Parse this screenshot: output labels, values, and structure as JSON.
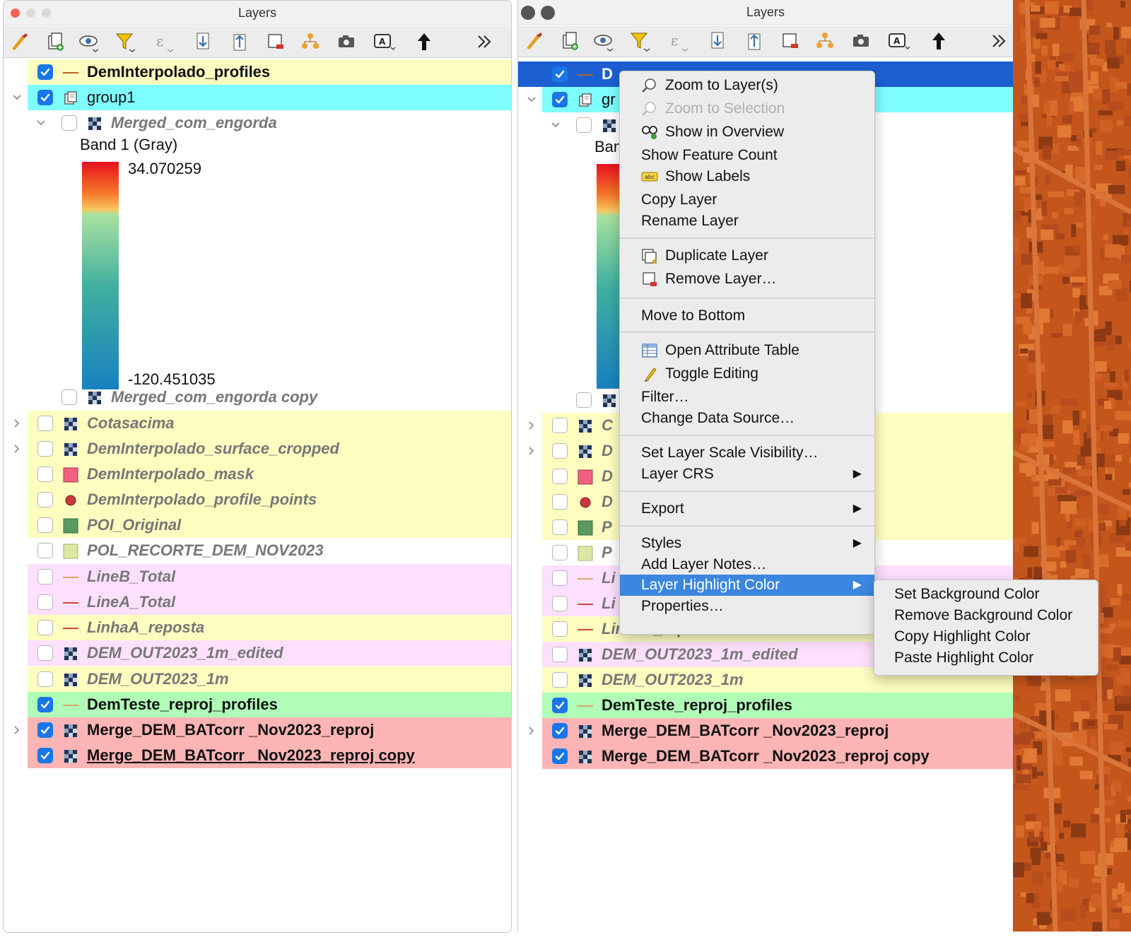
{
  "left_panel": {
    "title": "Layers",
    "layers": [
      {
        "label": "DemInterpolado_profiles",
        "checked": true,
        "style": "bold",
        "bg": "#fdfdc0",
        "symbol": "line-brown",
        "expander": ""
      },
      {
        "label": "group1",
        "checked": true,
        "style": "normal",
        "bg": "#7ffeff",
        "symbol": "group",
        "expander": "down"
      },
      {
        "label": "Merged_com_engorda",
        "checked": false,
        "style": "italic",
        "bg": "",
        "symbol": "raster",
        "expander": "down",
        "indent": 1
      },
      {
        "label": "Merged_com_engorda copy",
        "checked": false,
        "style": "italic",
        "bg": "",
        "symbol": "raster",
        "expander": "",
        "indent": 1
      },
      {
        "label": "Cotasacima",
        "checked": false,
        "style": "italic",
        "bg": "#fdfdc0",
        "symbol": "raster",
        "expander": "right"
      },
      {
        "label": "DemInterpolado_surface_cropped",
        "checked": false,
        "style": "italic",
        "bg": "#fdfdc0",
        "symbol": "raster",
        "expander": "right"
      },
      {
        "label": "DemInterpolado_mask",
        "checked": false,
        "style": "italic",
        "bg": "#fdfdc0",
        "symbol": "fill-pink",
        "expander": ""
      },
      {
        "label": "DemInterpolado_profile_points",
        "checked": false,
        "style": "italic",
        "bg": "#fdfdc0",
        "symbol": "point-red",
        "expander": ""
      },
      {
        "label": "POI_Original",
        "checked": false,
        "style": "italic",
        "bg": "#fdfdc0",
        "symbol": "fill-green",
        "expander": ""
      },
      {
        "label": "POL_RECORTE_DEM_NOV2023",
        "checked": false,
        "style": "italic",
        "bg": "",
        "symbol": "fill-lightgreen",
        "expander": ""
      },
      {
        "label": "LineB_Total",
        "checked": false,
        "style": "italic",
        "bg": "#fde0fd",
        "symbol": "line-tan",
        "expander": ""
      },
      {
        "label": "LineA_Total",
        "checked": false,
        "style": "italic",
        "bg": "#fde0fd",
        "symbol": "line-red",
        "expander": ""
      },
      {
        "label": "LinhaA_reposta",
        "checked": false,
        "style": "italic",
        "bg": "#fdfdc0",
        "symbol": "line-red",
        "expander": ""
      },
      {
        "label": "DEM_OUT2023_1m_edited",
        "checked": false,
        "style": "italic",
        "bg": "#fde0fd",
        "symbol": "raster",
        "expander": ""
      },
      {
        "label": "DEM_OUT2023_1m",
        "checked": false,
        "style": "italic",
        "bg": "#fdfdc0",
        "symbol": "raster",
        "expander": ""
      },
      {
        "label": "DemTeste_reproj_profiles",
        "checked": true,
        "style": "bold",
        "bg": "#b0fdb8",
        "symbol": "line-tan",
        "expander": ""
      },
      {
        "label": "Merge_DEM_BATcorr _Nov2023_reproj",
        "checked": true,
        "style": "bold",
        "bg": "#fdb4b4",
        "symbol": "raster",
        "expander": "right"
      },
      {
        "label": "Merge_DEM_BATcorr _Nov2023_reproj copy",
        "checked": true,
        "style": "bold-underline",
        "bg": "#fdb4b4",
        "symbol": "raster",
        "expander": ""
      }
    ],
    "legend": {
      "band": "Band 1 (Gray)",
      "max": "34.070259",
      "min": "-120.451035"
    }
  },
  "right_panel": {
    "title": "Layers",
    "layers_visible": [
      {
        "label": "D",
        "checked": true
      },
      {
        "label": "gr",
        "checked": true
      },
      {
        "label": "",
        "checked": false
      },
      {
        "label": "",
        "checked": false
      },
      {
        "label": "C",
        "checked": false
      },
      {
        "label": "D",
        "checked": false
      },
      {
        "label": "D",
        "checked": false
      },
      {
        "label": "D",
        "checked": false
      },
      {
        "label": "P",
        "checked": false
      },
      {
        "label": "P",
        "checked": false
      },
      {
        "label": "Li",
        "checked": false
      },
      {
        "label": "Li",
        "checked": false
      },
      {
        "label": "LinhaA_reposta",
        "checked": false
      },
      {
        "label": "DEM_OUT2023_1m_edited",
        "checked": false
      },
      {
        "label": "DEM_OUT2023_1m",
        "checked": false
      },
      {
        "label": "DemTeste_reproj_profiles",
        "checked": true
      },
      {
        "label": "Merge_DEM_BATcorr _Nov2023_reproj",
        "checked": true
      },
      {
        "label": "Merge_DEM_BATcorr _Nov2023_reproj copy",
        "checked": true
      }
    ],
    "legend_band_partial": "Ban"
  },
  "context_menu": {
    "items": [
      {
        "label": "Zoom to Layer(s)",
        "icon": "zoom-layer-icon"
      },
      {
        "label": "Zoom to Selection",
        "icon": "zoom-selection-icon",
        "disabled": true
      },
      {
        "label": "Show in Overview",
        "icon": "overview-icon"
      },
      {
        "label": "Show Feature Count",
        "icon": ""
      },
      {
        "label": "Show Labels",
        "icon": "labels-icon"
      },
      {
        "label": "Copy Layer",
        "icon": ""
      },
      {
        "label": "Rename Layer",
        "icon": ""
      },
      {
        "label": "Duplicate Layer",
        "icon": "duplicate-icon"
      },
      {
        "label": "Remove Layer…",
        "icon": "remove-layer-icon"
      },
      {
        "label": "Move to Bottom",
        "icon": ""
      },
      {
        "label": "Open Attribute Table",
        "icon": "attribute-table-icon"
      },
      {
        "label": "Toggle Editing",
        "icon": "pencil-icon"
      },
      {
        "label": "Filter…",
        "icon": ""
      },
      {
        "label": "Change Data Source…",
        "icon": ""
      },
      {
        "label": "Set Layer Scale Visibility…",
        "icon": ""
      },
      {
        "label": "Layer CRS",
        "icon": "",
        "submenu": true
      },
      {
        "label": "Export",
        "icon": "",
        "submenu": true
      },
      {
        "label": "Styles",
        "icon": "",
        "submenu": true
      },
      {
        "label": "Add Layer Notes…",
        "icon": ""
      },
      {
        "label": "Layer Highlight Color",
        "icon": "",
        "submenu": true,
        "highlighted": true
      },
      {
        "label": "Properties…",
        "icon": ""
      }
    ],
    "arrow_glyph": "▶"
  },
  "submenu": {
    "items": [
      "Set Background Color",
      "Remove Background Color",
      "Copy Highlight Color",
      "Paste Highlight Color"
    ]
  },
  "colors": {
    "accent": "#1976e8",
    "menu_highlight": "#3b86e0"
  }
}
